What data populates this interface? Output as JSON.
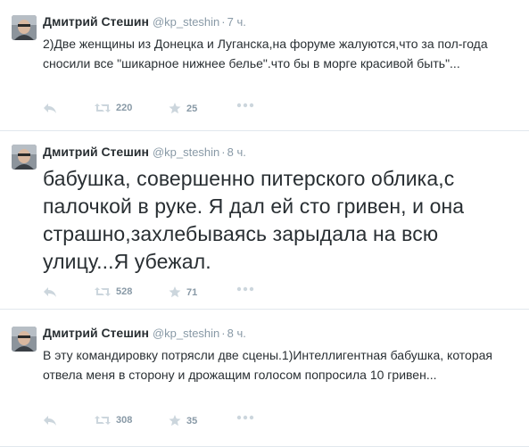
{
  "tweets": [
    {
      "name": "Дмитрий Стешин",
      "handle": "@kp_steshin",
      "separator": "·",
      "time": "7 ч.",
      "text": "2)Две женщины из Донецка и Луганска,на форуме жалуются,что за пол-года сносили все \"шикарное нижнее белье\".что бы в морге красивой быть\"...",
      "retweets": "220",
      "favorites": "25"
    },
    {
      "name": "Дмитрий Стешин",
      "handle": "@kp_steshin",
      "separator": "·",
      "time": "8 ч.",
      "text": "бабушка, совершенно питерского облика,с палочкой в руке. Я дал ей сто гривен, и она страшно,захлебываясь зарыдала на всю улицу...Я убежал.",
      "retweets": "528",
      "favorites": "71"
    },
    {
      "name": "Дмитрий Стешин",
      "handle": "@kp_steshin",
      "separator": "·",
      "time": "8 ч.",
      "text": "В эту командировку потрясли две сцены.1)Интеллигентная бабушка, которая отвела меня в сторону и дрожащим голосом попросила 10 гривен...",
      "retweets": "308",
      "favorites": "35"
    }
  ],
  "icons": {
    "reply": "reply-icon",
    "retweet": "retweet-icon",
    "favorite": "star-icon",
    "more": "more-icon"
  },
  "colors": {
    "meta": "#8899a6",
    "text": "#292f33",
    "divider": "#e1e8ed",
    "icon": "#ccd6dd"
  }
}
